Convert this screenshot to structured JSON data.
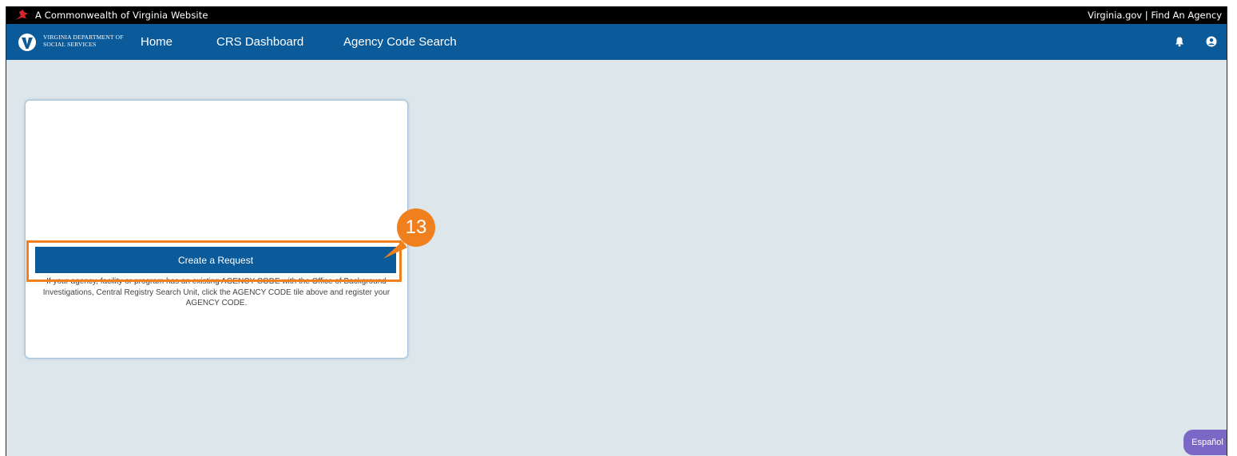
{
  "gov_banner": {
    "site_label": "A Commonwealth of Virginia Website",
    "virginia_gov": "Virginia.gov",
    "separator": "|",
    "find_agency": "Find An Agency"
  },
  "navbar": {
    "logo_line1": "VIRGINIA DEPARTMENT OF",
    "logo_line2": "SOCIAL SERVICES",
    "items": [
      {
        "label": "Home"
      },
      {
        "label": "CRS Dashboard"
      },
      {
        "label": "Agency Code Search"
      }
    ],
    "icons": [
      "bell-icon",
      "user-icon"
    ]
  },
  "card": {
    "button_label": "Create a Request",
    "description": "If your agency, facility or program has an existing AGENCY CODE with the Office of Background Investigations, Central Registry Search Unit, click the AGENCY CODE tile above and register your AGENCY CODE."
  },
  "callout": {
    "step_number": "13"
  },
  "language_button": "Español",
  "colors": {
    "nav_blue": "#0b5a9a",
    "background": "#dde6ea",
    "callout_orange": "#f0801e",
    "language_purple": "#7b68c6"
  }
}
